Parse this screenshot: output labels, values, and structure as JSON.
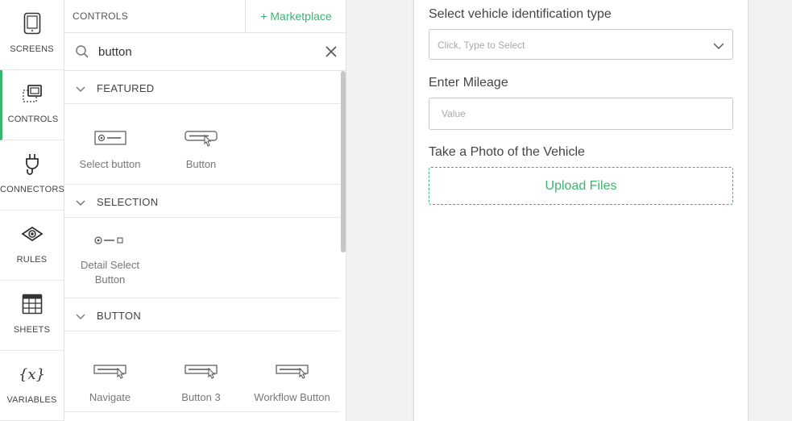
{
  "rail": {
    "items": [
      {
        "label": "SCREENS",
        "icon": "tablet-icon"
      },
      {
        "label": "CONTROLS",
        "icon": "controls-icon",
        "active": true
      },
      {
        "label": "CONNECTORS",
        "icon": "plug-icon"
      },
      {
        "label": "RULES",
        "icon": "eye-icon"
      },
      {
        "label": "SHEETS",
        "icon": "table-icon"
      },
      {
        "label": "VARIABLES",
        "icon": "variables-icon",
        "glyph": "{x}"
      }
    ]
  },
  "panel": {
    "title": "CONTROLS",
    "marketplace": "+ Marketplace",
    "search_value": "button",
    "sections": [
      {
        "title": "FEATURED",
        "items": [
          {
            "label": "Select button",
            "icon": "select-button-icon"
          },
          {
            "label": "Button",
            "icon": "button-icon"
          }
        ]
      },
      {
        "title": "SELECTION",
        "items": [
          {
            "label": "Detail Select Button",
            "icon": "detail-select-button-icon"
          }
        ]
      },
      {
        "title": "BUTTON",
        "items": [
          {
            "label": "Navigate",
            "icon": "navigate-icon"
          },
          {
            "label": "Button 3",
            "icon": "button-3-icon"
          },
          {
            "label": "Workflow Button",
            "icon": "workflow-button-icon"
          }
        ]
      }
    ]
  },
  "form": {
    "vehicle_id_label": "Select vehicle identification type",
    "vehicle_id_placeholder": "Click, Type to Select",
    "mileage_label": "Enter Mileage",
    "mileage_placeholder": "Value",
    "photo_label": "Take a Photo of the Vehicle",
    "upload_label": "Upload Files"
  },
  "colors": {
    "accent": "#3cb371",
    "page_background": "#f2f2f2"
  }
}
